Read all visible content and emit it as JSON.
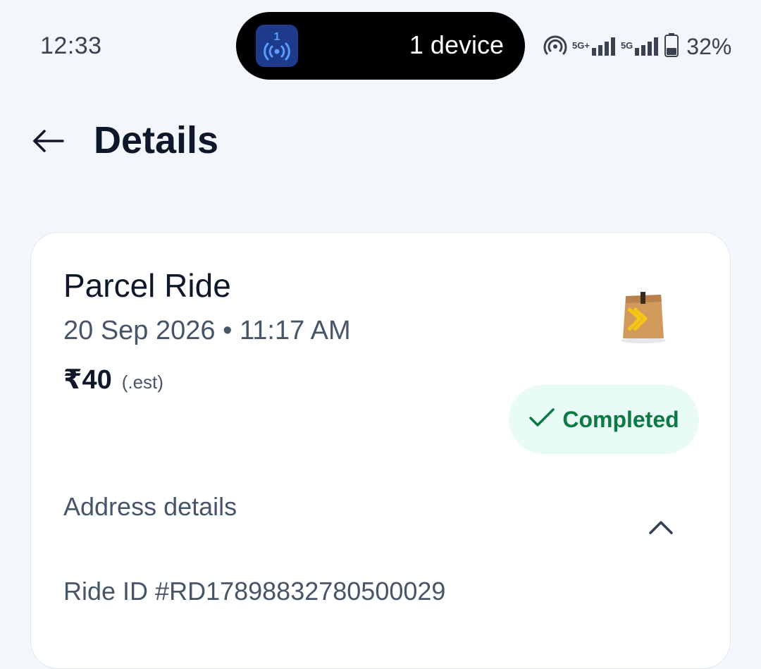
{
  "status_bar": {
    "time": "12:33",
    "pill_badge_count": "1",
    "pill_text": "1 device",
    "net1_label": "5G+",
    "net2_label": "5G",
    "battery_percent": "32%"
  },
  "header": {
    "title": "Details"
  },
  "card": {
    "title": "Parcel Ride",
    "date_time": "20 Sep 2026 • 11:17 AM",
    "fare_amount": "₹40",
    "fare_note": "(.est)",
    "status": "Completed",
    "address_label": "Address details",
    "ride_id": "Ride ID #RD17898832780500029"
  },
  "colors": {
    "status_green": "#0c7a45",
    "status_bg": "#e9fbf6",
    "pill_icon_bg": "#1e3a8a"
  },
  "icons": [
    "hotspot-icon",
    "back-arrow-icon",
    "parcel-bag-icon",
    "check-icon",
    "chevron-up-icon"
  ]
}
